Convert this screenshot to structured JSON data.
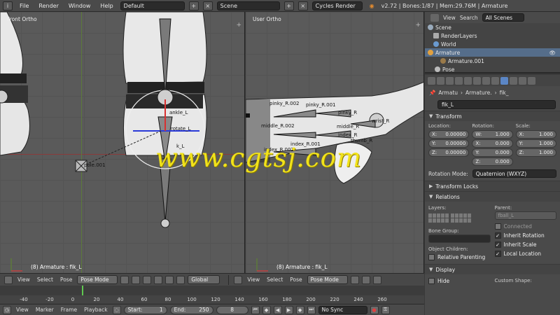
{
  "topbar": {
    "menus": [
      "File",
      "Render",
      "Window",
      "Help"
    ],
    "layout": "Default",
    "scene": "Scene",
    "engine": "Cycles Render",
    "info": "v2.72 | Bones:1/87 | Mem:29.76M | Armature"
  },
  "viewport_left": {
    "label": "Front Ortho",
    "status": "(8) Armature : fik_L",
    "bones": [
      "ankle_L",
      "rotate_L",
      "pole.001",
      "k_L"
    ]
  },
  "viewport_right": {
    "label": "User Ortho",
    "status": "(8) Armature : fik_L",
    "bones": [
      "pinky_R.002",
      "pinky_R.001",
      "pinky_R",
      "middle_R.002",
      "middle_R",
      "index_R",
      "wrist_R",
      "thumb_R",
      "index_R.001",
      "index_R.002",
      "index_R"
    ]
  },
  "watermark": "www.cgtsj.com",
  "vp_toolbar": {
    "left": {
      "view": "View",
      "select": "Select",
      "pose": "Pose",
      "mode": "Pose Mode",
      "orientation": "Global"
    },
    "right": {
      "view": "View",
      "select": "Select",
      "pose": "Pose",
      "mode": "Pose Mode"
    }
  },
  "timeline": {
    "ticks": [
      "-40",
      "-20",
      "0",
      "20",
      "40",
      "60",
      "80",
      "100",
      "120",
      "140",
      "160",
      "180",
      "200",
      "220",
      "240",
      "260"
    ]
  },
  "playbar": {
    "view": "View",
    "marker": "Marker",
    "frame": "Frame",
    "playback": "Playback",
    "start_label": "Start:",
    "start": "1",
    "end_label": "End:",
    "end": "250",
    "current": "8",
    "sync": "No Sync"
  },
  "outliner": {
    "view": "View",
    "search": "Search",
    "filter": "All Scenes",
    "items": [
      "Scene",
      "RenderLayers",
      "World",
      "Armature",
      "Armature.001",
      "Pose"
    ]
  },
  "properties": {
    "crumbs": [
      "Armatu",
      "Armature.",
      "fik_"
    ],
    "bone_name": "fik_L",
    "transform": {
      "title": "Transform",
      "location_label": "Location:",
      "rotation_label": "Rotation:",
      "scale_label": "Scale:",
      "location": [
        {
          "axis": "X:",
          "value": "0.00000"
        },
        {
          "axis": "Y:",
          "value": "0.00000"
        },
        {
          "axis": "Z:",
          "value": "0.00000"
        }
      ],
      "rotation": [
        {
          "axis": "W:",
          "value": "1.000"
        },
        {
          "axis": "X:",
          "value": "0.000"
        },
        {
          "axis": "Y:",
          "value": "0.000"
        },
        {
          "axis": "Z:",
          "value": "0.000"
        }
      ],
      "scale": [
        {
          "axis": "X:",
          "value": "1.000"
        },
        {
          "axis": "Y:",
          "value": "1.000"
        },
        {
          "axis": "Z:",
          "value": "1.000"
        }
      ],
      "rotation_mode_label": "Rotation Mode:",
      "rotation_mode": "Quaternion (WXYZ)"
    },
    "transform_locks": "Transform Locks",
    "relations": {
      "title": "Relations",
      "layers_label": "Layers:",
      "parent_label": "Parent:",
      "parent": "fball_L",
      "connected": "Connected",
      "inherit_rotation": "Inherit Rotation",
      "inherit_scale": "Inherit Scale",
      "local_location": "Local Location",
      "bone_group_label": "Bone Group:",
      "object_children_label": "Object Children:",
      "relative_parenting": "Relative Parenting"
    },
    "display": {
      "title": "Display",
      "hide": "Hide",
      "custom_shape": "Custom Shape:"
    }
  },
  "colors": {
    "accent_blue": "#5b86c5",
    "watermark": "#f1e21a",
    "timeline_cursor": "#5fc850"
  }
}
